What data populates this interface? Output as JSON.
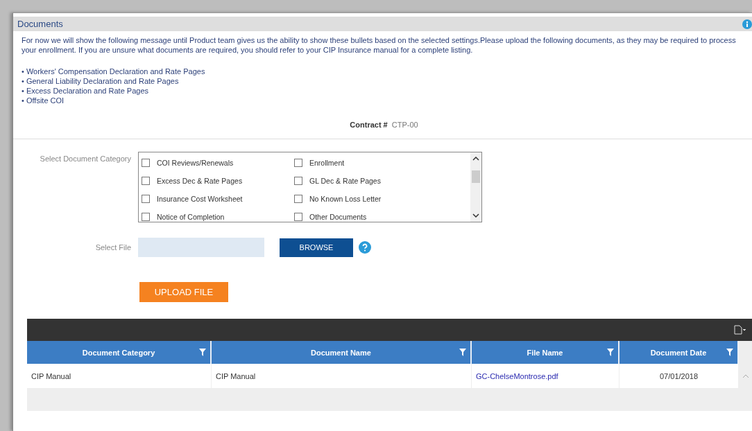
{
  "panel": {
    "title": "Documents"
  },
  "message": "For now we will show the following message until Product team gives us the ability to show these bullets based on the selected settings.Please upload the following documents, as they may be required to process your enrollment. If you are unsure what documents are required, you should refer to your CIP Insurance manual for a complete listing.",
  "bullets": [
    "• Workers' Compensation Declaration and Rate Pages",
    "• General Liability Declaration and Rate Pages",
    "• Excess Declaration and Rate Pages",
    "• Offsite COI"
  ],
  "contract": {
    "label": "Contract #",
    "value": "CTP-00"
  },
  "category": {
    "label": "Select Document Category",
    "options": [
      {
        "label": "COI Reviews/Renewals",
        "checked": false
      },
      {
        "label": "Enrollment",
        "checked": false
      },
      {
        "label": "Excess Dec & Rate Pages",
        "checked": false
      },
      {
        "label": "GL Dec & Rate Pages",
        "checked": false
      },
      {
        "label": "Insurance Cost Worksheet",
        "checked": false
      },
      {
        "label": "No Known Loss Letter",
        "checked": false
      },
      {
        "label": "Notice of Completion",
        "checked": false
      },
      {
        "label": "Other Documents",
        "checked": false
      }
    ]
  },
  "file": {
    "label": "Select File",
    "browse": "BROWSE"
  },
  "upload": "UPLOAD FILE",
  "table": {
    "columns": [
      "Document Category",
      "Document Name",
      "File Name",
      "Document Date"
    ],
    "rows": [
      [
        "CIP Manual",
        "CIP Manual",
        "GC-ChelseMontrose.pdf",
        "07/01/2018"
      ]
    ]
  }
}
